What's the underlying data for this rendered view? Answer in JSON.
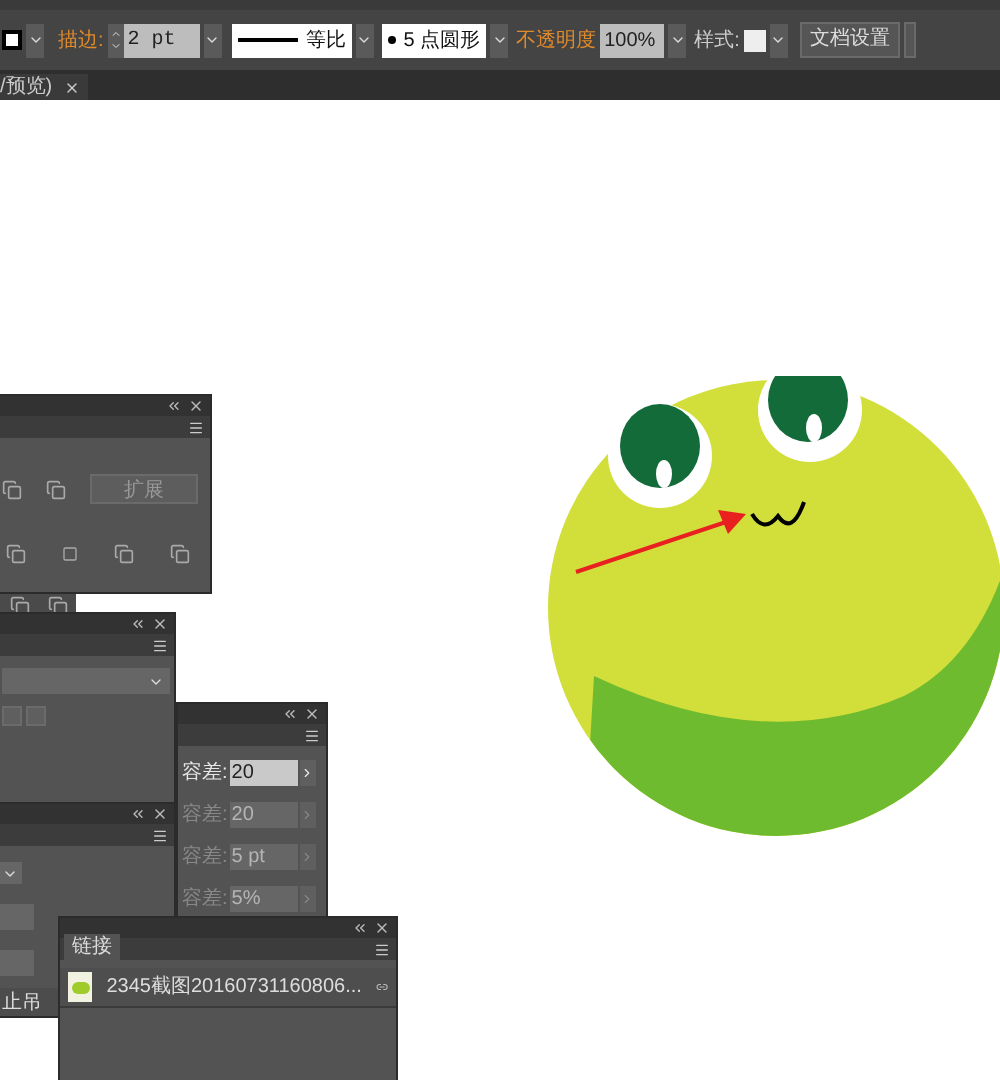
{
  "toolbar": {
    "stroke_label": "描边:",
    "stroke_weight": "2 pt",
    "profile": "等比",
    "brush": "5 点圆形",
    "opacity_label": "不透明度",
    "opacity": "100%",
    "style_label": "样式:",
    "doc_setup_button": "文档设置"
  },
  "doc_tab": {
    "title": "/预览)"
  },
  "pathfinder_panel": {
    "expand_button": "扩展"
  },
  "tolerance_panel": {
    "fields": [
      {
        "label": "容差:",
        "value": "20",
        "disabled": false
      },
      {
        "label": "容差:",
        "value": "20",
        "disabled": true
      },
      {
        "label": "容差:",
        "value": "5 pt",
        "disabled": true
      },
      {
        "label": "容差:",
        "value": "5%",
        "disabled": true
      }
    ]
  },
  "trace_panel": {
    "stop_button": "止吊"
  },
  "links_panel": {
    "tab": "链接",
    "items": [
      {
        "name": "2345截图20160731160806..."
      }
    ]
  }
}
